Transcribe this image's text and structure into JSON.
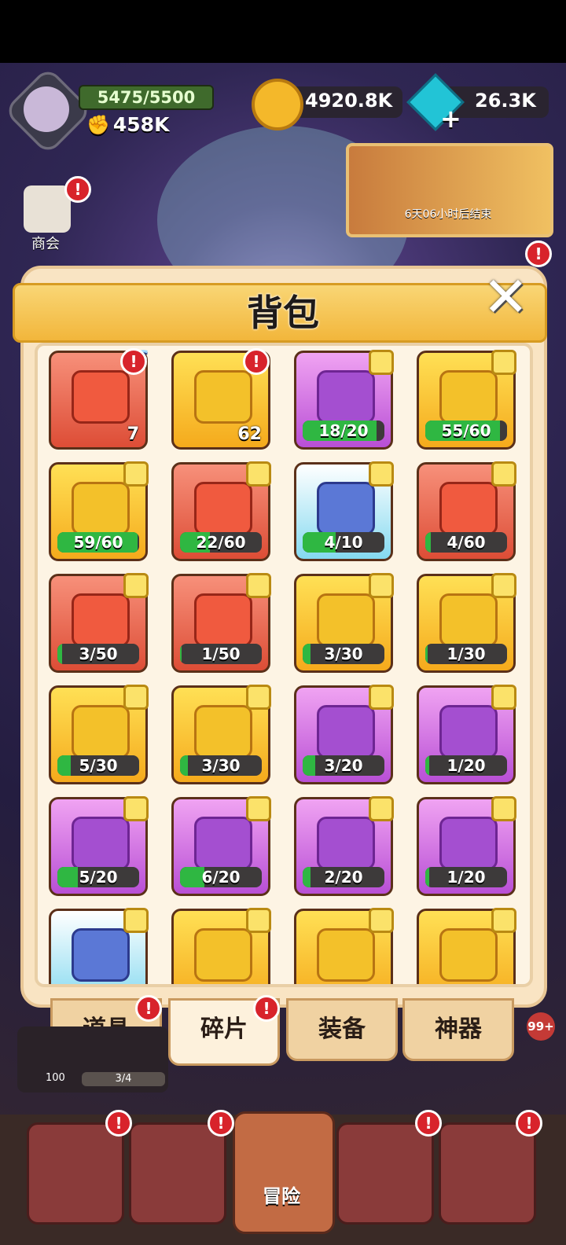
{
  "hud": {
    "hp": "5475/5500",
    "power": "458K",
    "gold": "4920.8K",
    "gems": "26.3K",
    "event_timer": "6天06小时后结束",
    "shop_label": "商会"
  },
  "panel": {
    "title": "背包",
    "close_icon": "close-icon"
  },
  "items": [
    {
      "kind": "red",
      "type": "count",
      "count": "7",
      "ssr": "SS",
      "badge": "!"
    },
    {
      "kind": "yel",
      "type": "count",
      "count": "62",
      "badge": "!"
    },
    {
      "kind": "pur",
      "type": "progress",
      "text": "18/20",
      "progress": 0.9
    },
    {
      "kind": "yel",
      "type": "progress",
      "text": "55/60",
      "progress": 0.917
    },
    {
      "kind": "yel",
      "type": "progress",
      "text": "59/60",
      "progress": 0.983
    },
    {
      "kind": "red",
      "type": "progress",
      "text": "22/60",
      "progress": 0.367
    },
    {
      "kind": "wht",
      "type": "progress",
      "text": "4/10",
      "progress": 0.4
    },
    {
      "kind": "red",
      "type": "progress",
      "text": "4/60",
      "progress": 0.067
    },
    {
      "kind": "red",
      "type": "progress",
      "text": "3/50",
      "progress": 0.06
    },
    {
      "kind": "red",
      "type": "progress",
      "text": "1/50",
      "progress": 0.02
    },
    {
      "kind": "yel",
      "type": "progress",
      "text": "3/30",
      "progress": 0.1
    },
    {
      "kind": "yel",
      "type": "progress",
      "text": "1/30",
      "progress": 0.033
    },
    {
      "kind": "yel",
      "type": "progress",
      "text": "5/30",
      "progress": 0.167
    },
    {
      "kind": "yel",
      "type": "progress",
      "text": "3/30",
      "progress": 0.1
    },
    {
      "kind": "pur",
      "type": "progress",
      "text": "3/20",
      "progress": 0.15
    },
    {
      "kind": "pur",
      "type": "progress",
      "text": "1/20",
      "progress": 0.05
    },
    {
      "kind": "pur",
      "type": "progress",
      "text": "5/20",
      "progress": 0.25
    },
    {
      "kind": "pur",
      "type": "progress",
      "text": "6/20",
      "progress": 0.3
    },
    {
      "kind": "pur",
      "type": "progress",
      "text": "2/20",
      "progress": 0.1
    },
    {
      "kind": "pur",
      "type": "progress",
      "text": "1/20",
      "progress": 0.05
    },
    {
      "kind": "wht",
      "type": "partial"
    },
    {
      "kind": "yel",
      "type": "partial"
    },
    {
      "kind": "yel",
      "type": "partial"
    },
    {
      "kind": "yel",
      "type": "partial"
    }
  ],
  "tabs": [
    "道具",
    "碎片",
    "装备",
    "神器"
  ],
  "active_tab": 1,
  "bottom": {
    "hint_num": "100",
    "hint_progress": "3/4",
    "badge_99": "99+",
    "center_label": "冒险"
  },
  "colors": {
    "red_cell": "#dd4d36",
    "yellow_cell": "#f5aa1c",
    "purple_cell": "#b84fd5",
    "green_bar": "#2fb742"
  }
}
